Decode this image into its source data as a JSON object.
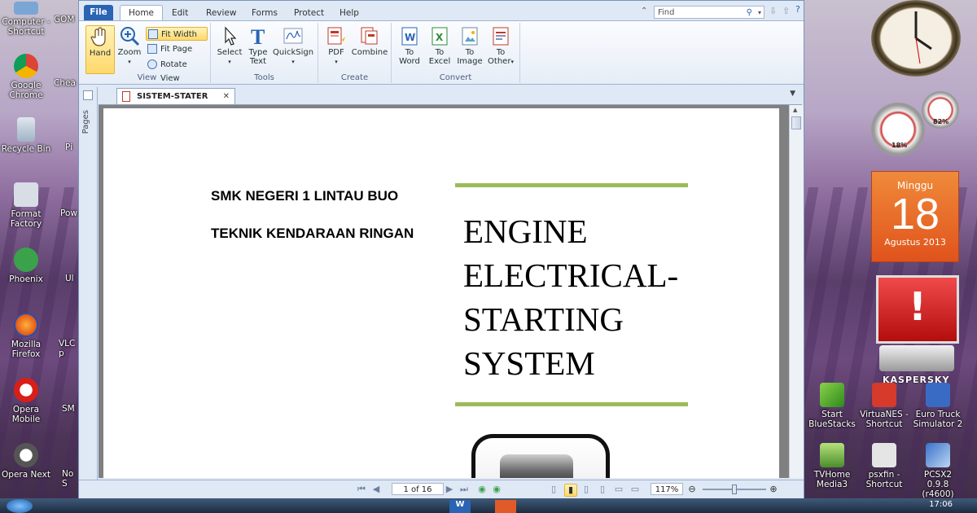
{
  "desktop": {
    "left_icons": [
      {
        "label": "Computer - Shortcut"
      },
      {
        "label": "Google Chrome"
      },
      {
        "label": "Recycle Bin"
      },
      {
        "label": "Format Factory"
      },
      {
        "label": "Phoenix"
      },
      {
        "label": "Mozilla Firefox"
      },
      {
        "label": "Opera Mobile"
      },
      {
        "label": "Opera Next"
      }
    ],
    "partial_icons": [
      "GOM",
      "Chea",
      "Pi",
      "Pow",
      "Ul",
      "VLC p",
      "SM",
      "No S"
    ],
    "right_icons": [
      {
        "label": "Start BlueStacks"
      },
      {
        "label": "VirtuaNES - Shortcut"
      },
      {
        "label": "Euro Truck Simulator 2"
      },
      {
        "label": "TVHome Media3"
      },
      {
        "label": "psxfin - Shortcut"
      },
      {
        "label": "PCSX2 0.9.8 (r4600)"
      }
    ]
  },
  "gadgets": {
    "meter_cpu": "18%",
    "meter_mem": "82%",
    "calendar_day_name": "Minggu",
    "calendar_day": "18",
    "calendar_month_year": "Agustus 2013",
    "kaspersky": "KASPERSKY",
    "taskbar_time": "17:06"
  },
  "ribbon": {
    "tabs": [
      "File",
      "Home",
      "Edit",
      "Review",
      "Forms",
      "Protect",
      "Help"
    ],
    "active_tab": "Home",
    "find_placeholder": "Find",
    "groups": {
      "view": {
        "label": "View",
        "hand": "Hand",
        "zoom": "Zoom",
        "fit_width": "Fit Width",
        "fit_page": "Fit Page",
        "rotate_view": "Rotate View"
      },
      "tools": {
        "label": "Tools",
        "select": "Select",
        "type_text": "Type Text",
        "quicksign": "QuickSign"
      },
      "create": {
        "label": "Create",
        "pdf": "PDF",
        "combine": "Combine"
      },
      "convert": {
        "label": "Convert",
        "to_word": "To Word",
        "to_excel": "To Excel",
        "to_image": "To Image",
        "to_other": "To Other"
      }
    }
  },
  "side_panel": {
    "pages_label": "Pages"
  },
  "document": {
    "tab_name": "SISTEM-STATER",
    "school_name": "SMK NEGERI 1 LINTAU BUO",
    "department": "TEKNIK KENDARAAN RINGAN",
    "title_lines": [
      "ENGINE",
      "ELECTRICAL-",
      "STARTING",
      "SYSTEM"
    ],
    "accent_color": "#9bbb59"
  },
  "statusbar": {
    "page_indicator": "1 of 16",
    "zoom": "117%"
  }
}
